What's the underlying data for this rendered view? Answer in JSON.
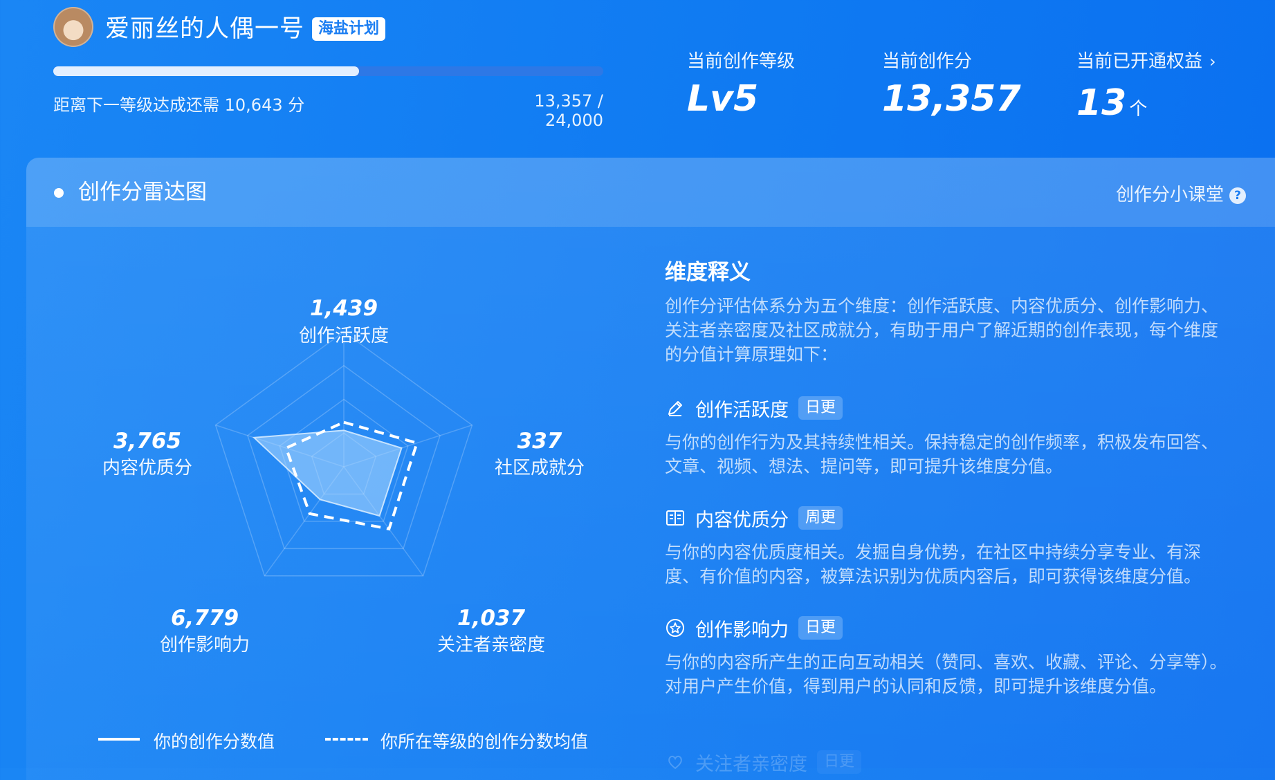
{
  "profile": {
    "username": "爱丽丝的人偶一号",
    "badge": "海盐计划",
    "progress_note": "距离下一等级达成还需 10,643 分",
    "progress_count": "13,357 / 24,000",
    "progress_fraction": 0.5565
  },
  "stats": [
    {
      "label": "当前创作等级",
      "value": "Lv5",
      "unit": ""
    },
    {
      "label": "当前创作分",
      "value": "13,357",
      "unit": ""
    },
    {
      "label": "当前已开通权益",
      "value": "13",
      "unit": "个",
      "chevron": "›"
    }
  ],
  "panel": {
    "title": "创作分雷达图",
    "help_label": "创作分小课堂",
    "help_icon": "?"
  },
  "radar": {
    "axes": [
      {
        "name": "创作活跃度",
        "value": "1,439"
      },
      {
        "name": "社区成就分",
        "value": "337"
      },
      {
        "name": "关注者亲密度",
        "value": "1,037"
      },
      {
        "name": "创作影响力",
        "value": "6,779"
      },
      {
        "name": "内容优质分",
        "value": "3,765"
      }
    ],
    "your_values": [
      0.27,
      0.45,
      0.45,
      0.3,
      0.7
    ],
    "average_values": [
      0.33,
      0.57,
      0.57,
      0.43,
      0.45
    ],
    "legend": {
      "yours": "你的创作分数值",
      "average": "你所在等级的创作分数均值"
    }
  },
  "explain": {
    "title": "维度释义",
    "intro": "创作分评估体系分为五个维度：创作活跃度、内容优质分、创作影响力、关注者亲密度及社区成就分，有助于用户了解近期的创作表现，每个维度的分值计算原理如下：",
    "items": [
      {
        "icon": "pencil-icon",
        "name": "创作活跃度",
        "tag": "日更",
        "desc": "与你的创作行为及其持续性相关。保持稳定的创作频率，积极发布回答、文章、视频、想法、提问等，即可提升该维度分值。"
      },
      {
        "icon": "book-icon",
        "name": "内容优质分",
        "tag": "周更",
        "desc": "与你的内容优质度相关。发掘自身优势，在社区中持续分享专业、有深度、有价值的内容，被算法识别为优质内容后，即可获得该维度分值。"
      },
      {
        "icon": "star-icon",
        "name": "创作影响力",
        "tag": "日更",
        "desc": "与你的内容所产生的正向互动相关（赞同、喜欢、收藏、评论、分享等）。对用户产生价值，得到用户的认同和反馈，即可提升该维度分值。"
      },
      {
        "icon": "heart-icon",
        "name": "关注者亲密度",
        "tag": "日更",
        "desc": ""
      }
    ]
  },
  "colors": {
    "background": "#1580f4",
    "badge_text": "#1a7df2",
    "radar_fill": "#8cc8ff"
  }
}
